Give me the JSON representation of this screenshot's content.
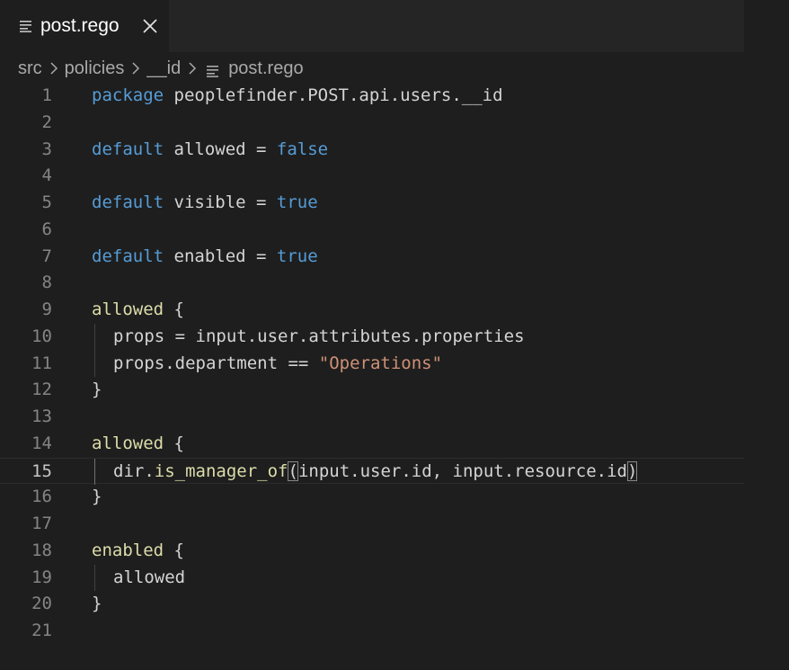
{
  "tab": {
    "title": "post.rego",
    "icon": "lines-file-icon",
    "close_icon": "close-icon"
  },
  "breadcrumb": {
    "items": [
      "src",
      "policies",
      "__id",
      "post.rego"
    ],
    "separator_icon": "chevron-right-icon"
  },
  "editor": {
    "active_line": 15,
    "lines": [
      {
        "n": "1",
        "tokens": [
          {
            "t": "package",
            "c": "kw"
          },
          {
            "t": " peoplefinder.POST.api.users.__id",
            "c": "pl"
          }
        ]
      },
      {
        "n": "2",
        "tokens": []
      },
      {
        "n": "3",
        "tokens": [
          {
            "t": "default",
            "c": "kw"
          },
          {
            "t": " allowed = ",
            "c": "pl"
          },
          {
            "t": "false",
            "c": "kw"
          }
        ]
      },
      {
        "n": "4",
        "tokens": []
      },
      {
        "n": "5",
        "tokens": [
          {
            "t": "default",
            "c": "kw"
          },
          {
            "t": " visible = ",
            "c": "pl"
          },
          {
            "t": "true",
            "c": "kw"
          }
        ]
      },
      {
        "n": "6",
        "tokens": []
      },
      {
        "n": "7",
        "tokens": [
          {
            "t": "default",
            "c": "kw"
          },
          {
            "t": " enabled = ",
            "c": "pl"
          },
          {
            "t": "true",
            "c": "kw"
          }
        ]
      },
      {
        "n": "8",
        "tokens": []
      },
      {
        "n": "9",
        "tokens": [
          {
            "t": "allowed",
            "c": "fn"
          },
          {
            "t": " {",
            "c": "pl"
          }
        ]
      },
      {
        "n": "10",
        "indent": true,
        "tokens": [
          {
            "t": "props = input.user.attributes.properties",
            "c": "pl"
          }
        ]
      },
      {
        "n": "11",
        "indent": true,
        "tokens": [
          {
            "t": "props.department == ",
            "c": "pl"
          },
          {
            "t": "\"Operations\"",
            "c": "str"
          }
        ]
      },
      {
        "n": "12",
        "tokens": [
          {
            "t": "}",
            "c": "pl"
          }
        ]
      },
      {
        "n": "13",
        "tokens": []
      },
      {
        "n": "14",
        "tokens": [
          {
            "t": "allowed",
            "c": "fn"
          },
          {
            "t": " {",
            "c": "pl"
          }
        ]
      },
      {
        "n": "15",
        "indent": true,
        "tokens": [
          {
            "t": "dir.",
            "c": "pl"
          },
          {
            "t": "is_manager_of",
            "c": "fn"
          },
          {
            "t": "(",
            "c": "pl",
            "match": true
          },
          {
            "t": "input.user.id, input.resource.id",
            "c": "pl"
          },
          {
            "t": ")",
            "c": "pl",
            "match": true
          }
        ]
      },
      {
        "n": "16",
        "tokens": [
          {
            "t": "}",
            "c": "pl"
          }
        ]
      },
      {
        "n": "17",
        "tokens": []
      },
      {
        "n": "18",
        "tokens": [
          {
            "t": "enabled",
            "c": "fn"
          },
          {
            "t": " {",
            "c": "pl"
          }
        ]
      },
      {
        "n": "19",
        "indent": true,
        "tokens": [
          {
            "t": "allowed",
            "c": "pl"
          }
        ]
      },
      {
        "n": "20",
        "tokens": [
          {
            "t": "}",
            "c": "pl"
          }
        ]
      },
      {
        "n": "21",
        "tokens": []
      }
    ]
  },
  "colors": {
    "background": "#1e1e1e",
    "keyword": "#569cd6",
    "function": "#dcdcaa",
    "string": "#ce9178",
    "text": "#d4d4d4",
    "line_number": "#858585"
  }
}
